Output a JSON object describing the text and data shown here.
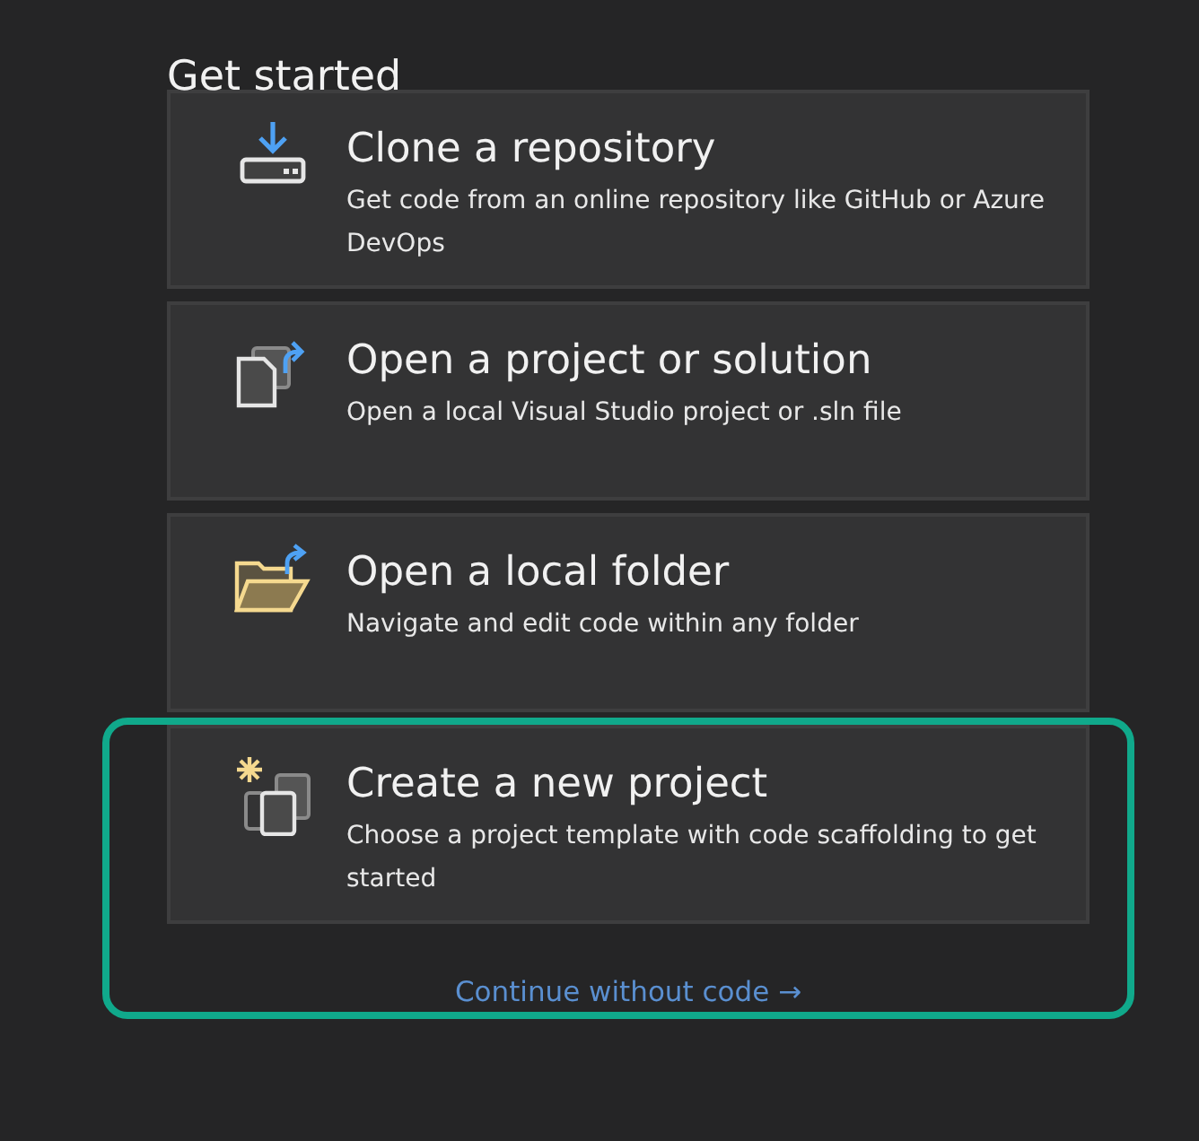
{
  "heading": "Get started",
  "cards": [
    {
      "kind": "clone",
      "title": "Clone a repository",
      "description": "Get code from an online repository like GitHub or Azure DevOps"
    },
    {
      "kind": "open-project",
      "title": "Open a project or solution",
      "description": "Open a local Visual Studio project or .sln file"
    },
    {
      "kind": "open-folder",
      "title": "Open a local folder",
      "description": "Navigate and edit code within any folder"
    },
    {
      "kind": "create",
      "title": "Create a new project",
      "description": "Choose a project template with code scaffolding to get started"
    }
  ],
  "continue_link": "Continue without code →",
  "highlight": true
}
